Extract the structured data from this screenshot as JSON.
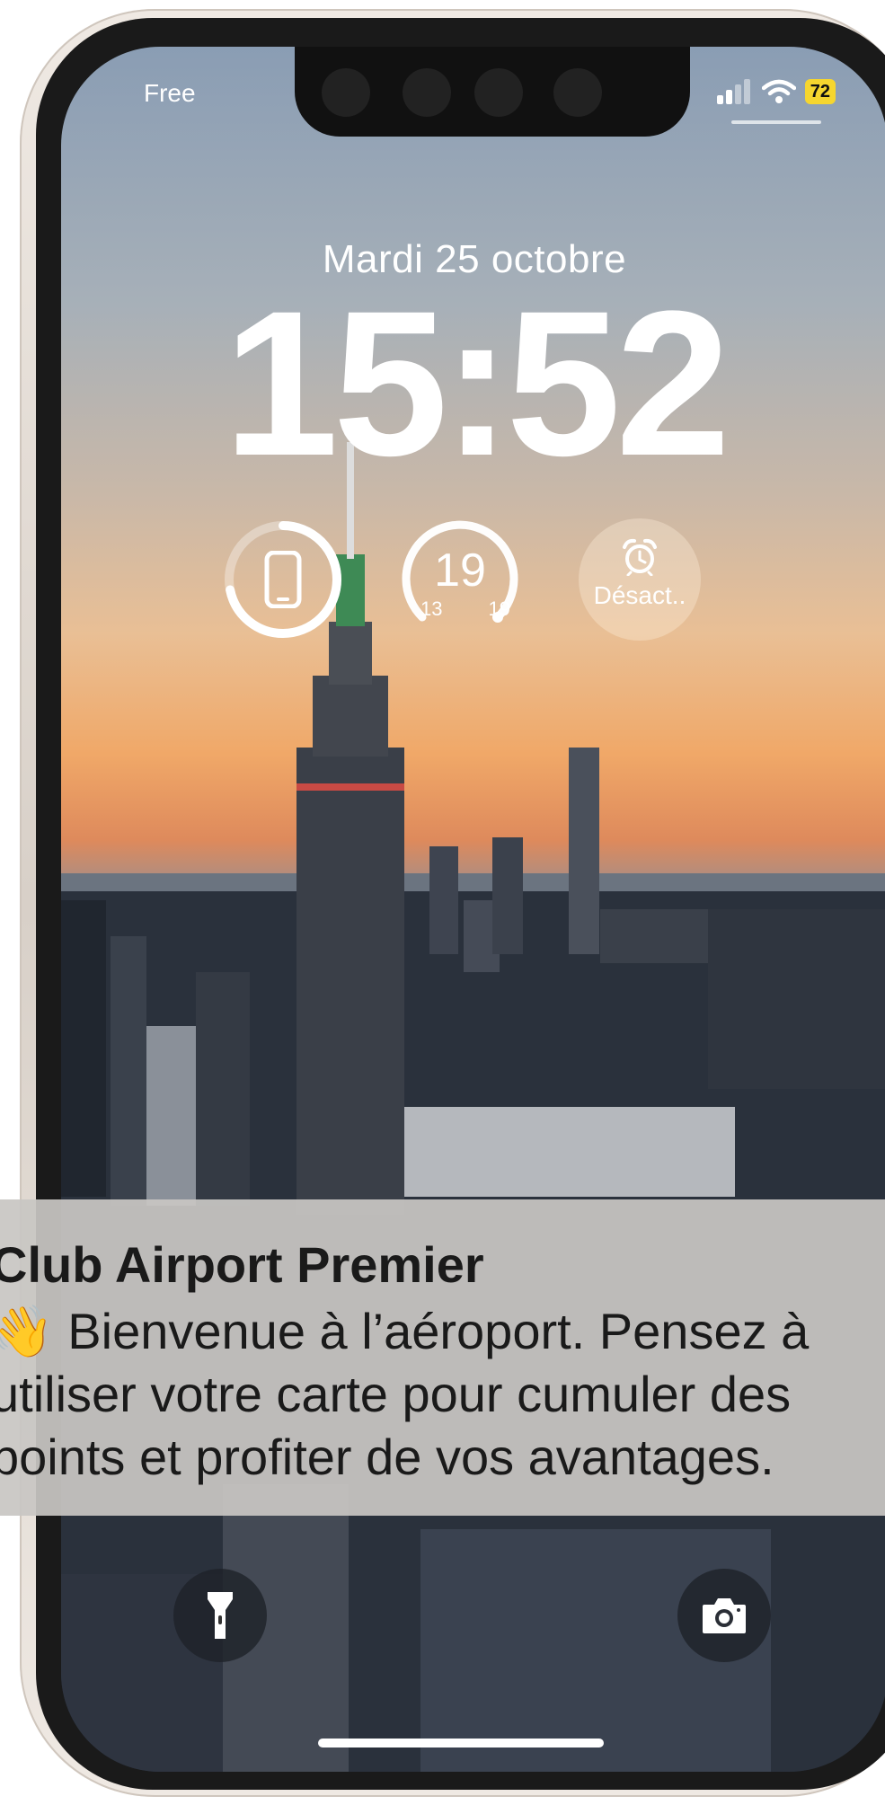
{
  "status_bar": {
    "carrier": "Free",
    "battery_level": "72",
    "battery_color": "#f6d62f"
  },
  "lock_screen": {
    "date": "Mardi 25 octobre",
    "time": "15:52"
  },
  "widgets": {
    "device_battery": {
      "icon": "phone-icon"
    },
    "weather": {
      "current": "19",
      "low": "13",
      "high": "19"
    },
    "alarm": {
      "icon": "alarm-clock-icon",
      "label": "Désact.."
    }
  },
  "notification": {
    "title": "Club Airport Premier",
    "emoji": "👋",
    "line1": "Bienvenue à l’aéroport. Pensez à",
    "line2": "utiliser votre carte pour cumuler des",
    "line3": "points et profiter de vos avantages."
  },
  "quick_actions": {
    "left": {
      "icon": "flashlight-icon"
    },
    "right": {
      "icon": "camera-icon"
    }
  }
}
